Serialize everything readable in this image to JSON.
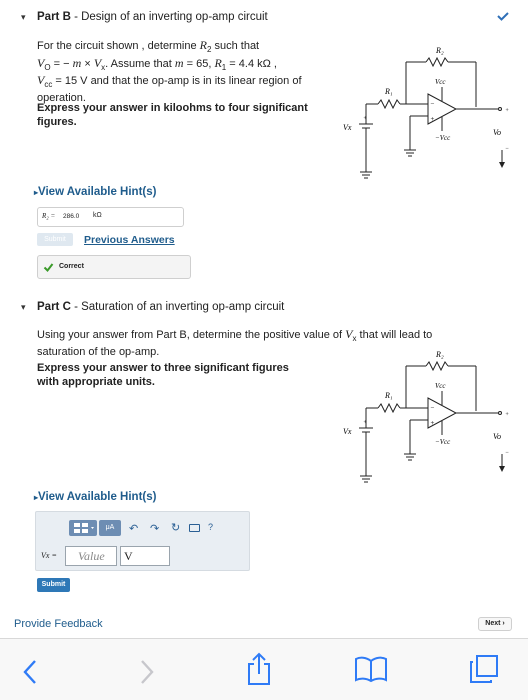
{
  "partB": {
    "label": "Part B",
    "title": " - Design of an inverting op-amp circuit",
    "q1": "For the circuit shown , determine ",
    "q1_var": "R",
    "q1_sub": "2",
    "q1_tail": " such that",
    "q2": "V",
    "q2_sub": "O",
    "q2_mid": " = − m × V",
    "q2_sub2": "x",
    "q2_tail": ". Assume that m = 65, R₁ = 4.4 kΩ ,",
    "q3": "Vcc = 15 V and that the op-amp is in its linear region of",
    "q4": "operation.",
    "instr1": "Express your answer in kiloohms to four significant",
    "instr2": "figures.",
    "hint_label": "View Available Hint(s)",
    "answer_var": "R₂ =",
    "answer_value": "286.0",
    "answer_unit": "kΩ",
    "submit_label": "Submit",
    "previous_answers": "Previous Answers",
    "correct_label": "Correct"
  },
  "partC": {
    "label": "Part C",
    "title": " - Saturation of an inverting op-amp circuit",
    "q1": "Using your answer from Part B, determine the positive value of Vx that will lead to",
    "q2": "saturation of the op-amp.",
    "instr1": "Express your answer to three significant figures",
    "instr2": "with appropriate units.",
    "hint_label": "View Available Hint(s)",
    "answer_var": "Vx =",
    "value_placeholder": "Value",
    "unit_value": "V",
    "submit_label": "Submit"
  },
  "circuit": {
    "r2": "R₂",
    "r1": "R₁",
    "vcc": "Vcc",
    "neg_vcc": "−Vcc",
    "vx": "Vx",
    "vo": "Vo",
    "plus": "+",
    "minus": "−"
  },
  "footer": {
    "feedback": "Provide Feedback",
    "next": "Next"
  },
  "toolbar": {
    "help": "?",
    "mu": "μA"
  },
  "colors": {
    "link": "#1f5c8c",
    "submit": "#2e78b7",
    "correct_check": "#3a9a2a",
    "ios_blue": "#2f7bf6"
  }
}
